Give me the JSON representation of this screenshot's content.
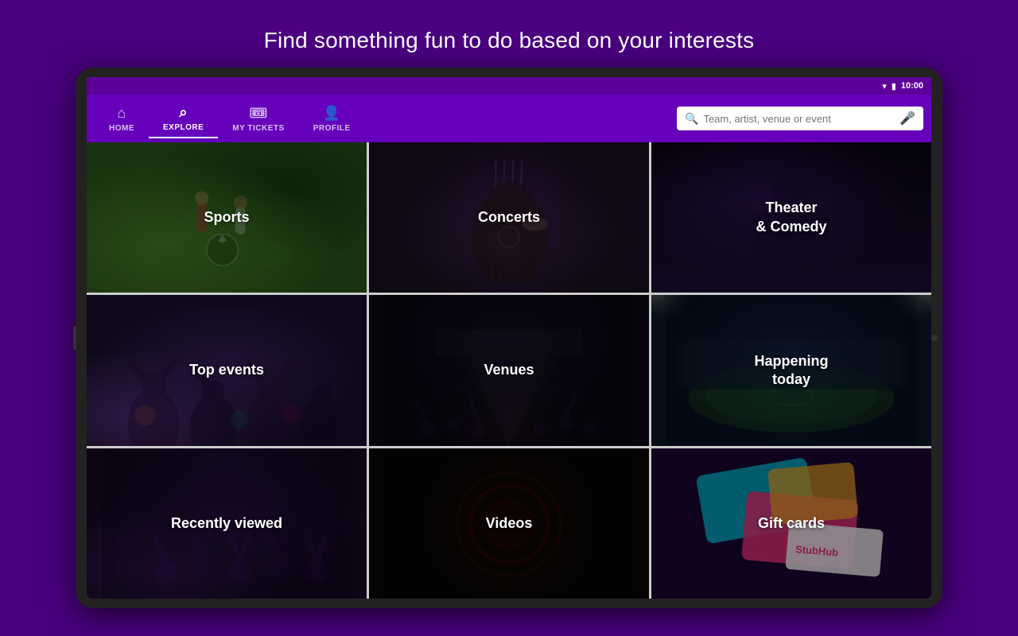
{
  "page": {
    "title": "Find something fun to do based on your interests",
    "background_color": "#4a0080"
  },
  "status_bar": {
    "time": "10:00"
  },
  "nav": {
    "tabs": [
      {
        "id": "home",
        "label": "HOME",
        "icon": "🏠",
        "active": false
      },
      {
        "id": "explore",
        "label": "EXPLORE",
        "icon": "🔍",
        "active": true
      },
      {
        "id": "my-tickets",
        "label": "MY TICKETS",
        "icon": "🎟",
        "active": false
      },
      {
        "id": "profile",
        "label": "PROFILE",
        "icon": "👤",
        "active": false
      }
    ],
    "search_placeholder": "Team, artist, venue or event"
  },
  "grid": {
    "cells": [
      {
        "id": "sports",
        "label": "Sports",
        "bg": "sports"
      },
      {
        "id": "concerts",
        "label": "Concerts",
        "bg": "concerts"
      },
      {
        "id": "theater",
        "label": "Theater\n& Comedy",
        "bg": "theater"
      },
      {
        "id": "top-events",
        "label": "Top events",
        "bg": "top-events"
      },
      {
        "id": "venues",
        "label": "Venues",
        "bg": "venues"
      },
      {
        "id": "happening-today",
        "label": "Happening\ntoday",
        "bg": "happening"
      },
      {
        "id": "recently-viewed",
        "label": "Recently viewed",
        "bg": "recently"
      },
      {
        "id": "videos",
        "label": "Videos",
        "bg": "videos"
      },
      {
        "id": "gift-cards",
        "label": "Gift cards",
        "bg": "giftcards"
      }
    ]
  }
}
